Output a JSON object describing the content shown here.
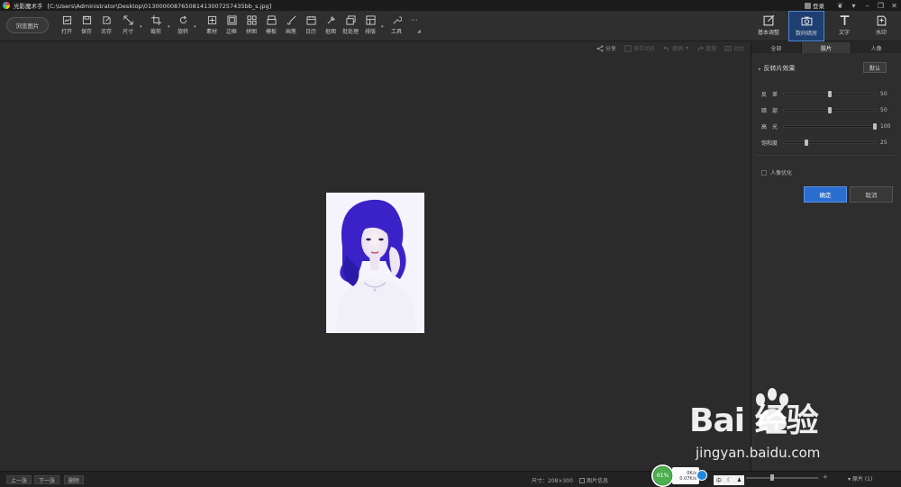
{
  "window": {
    "app_title": "光影魔术手",
    "file_path": "[C:\\Users\\Administrator\\Desktop\\013000008765081413007257435bb_s.jpg]",
    "login_label": "登录"
  },
  "toolbar": {
    "browse_label": "浏览图片",
    "tools": [
      {
        "label": "打开",
        "icon": "open-icon"
      },
      {
        "label": "保存",
        "icon": "save-icon"
      },
      {
        "label": "另存",
        "icon": "save-as-icon"
      },
      {
        "label": "尺寸",
        "icon": "resize-icon"
      },
      {
        "label": "裁剪",
        "icon": "crop-icon"
      },
      {
        "label": "旋转",
        "icon": "rotate-icon"
      },
      {
        "label": "素材",
        "icon": "material-icon"
      },
      {
        "label": "边框",
        "icon": "frame-icon"
      },
      {
        "label": "拼图",
        "icon": "collage-icon"
      },
      {
        "label": "模板",
        "icon": "template-icon"
      },
      {
        "label": "画笔",
        "icon": "brush-icon"
      },
      {
        "label": "日历",
        "icon": "calendar-icon"
      },
      {
        "label": "抠图",
        "icon": "cutout-icon"
      },
      {
        "label": "批处理",
        "icon": "batch-icon"
      },
      {
        "label": "排版",
        "icon": "layout-icon"
      },
      {
        "label": "工具",
        "icon": "tool-icon"
      }
    ],
    "more_label": "···"
  },
  "right_tabs": [
    {
      "label": "基本调整",
      "icon": "adjust-icon",
      "active": false
    },
    {
      "label": "数码暗房",
      "icon": "darkroom-icon",
      "active": true
    },
    {
      "label": "文字",
      "icon": "text-icon",
      "active": false
    },
    {
      "label": "水印",
      "icon": "watermark-icon",
      "active": false
    }
  ],
  "canvas_tools": [
    {
      "label": "分享",
      "icon": "share-icon",
      "enabled": true
    },
    {
      "label": "保存动态",
      "icon": "save-dynamic-icon",
      "enabled": false
    },
    {
      "label": "撤销",
      "icon": "undo-icon",
      "enabled": false
    },
    {
      "label": "重做",
      "icon": "redo-icon",
      "enabled": false
    },
    {
      "label": "对比",
      "icon": "compare-icon",
      "enabled": false
    }
  ],
  "panel": {
    "subtabs": [
      {
        "label": "全部",
        "active": false
      },
      {
        "label": "胶片",
        "active": true
      },
      {
        "label": "人像",
        "active": false
      }
    ],
    "effect_title": "反转片效果",
    "default_label": "默认",
    "sliders": [
      {
        "name": "反　差",
        "value": 50,
        "max": 100
      },
      {
        "name": "暗　部",
        "value": 50,
        "max": 100
      },
      {
        "name": "高　光",
        "value": 100,
        "max": 100
      },
      {
        "name": "饱和度",
        "value": 25,
        "max": 100
      }
    ],
    "portrait_option": "人像优化",
    "ok_label": "确定",
    "cancel_label": "取消"
  },
  "bottom": {
    "prev_label": "上一张",
    "next_label": "下一张",
    "delete_label": "删除",
    "size_info": "尺寸：208×300",
    "image_info_label": "图片信息",
    "cpu_percent": "61%",
    "net_up": "0K/s",
    "net_down": "0.07K/s",
    "ime_label": "中",
    "zoom_label": "原片 (1)"
  },
  "watermark": {
    "brand": "Bai 经验",
    "url": "jingyan.baidu.com"
  },
  "colors": {
    "accent": "#2c6ed0",
    "active_tab": "#1e3f72",
    "background": "#2b2b2b"
  }
}
